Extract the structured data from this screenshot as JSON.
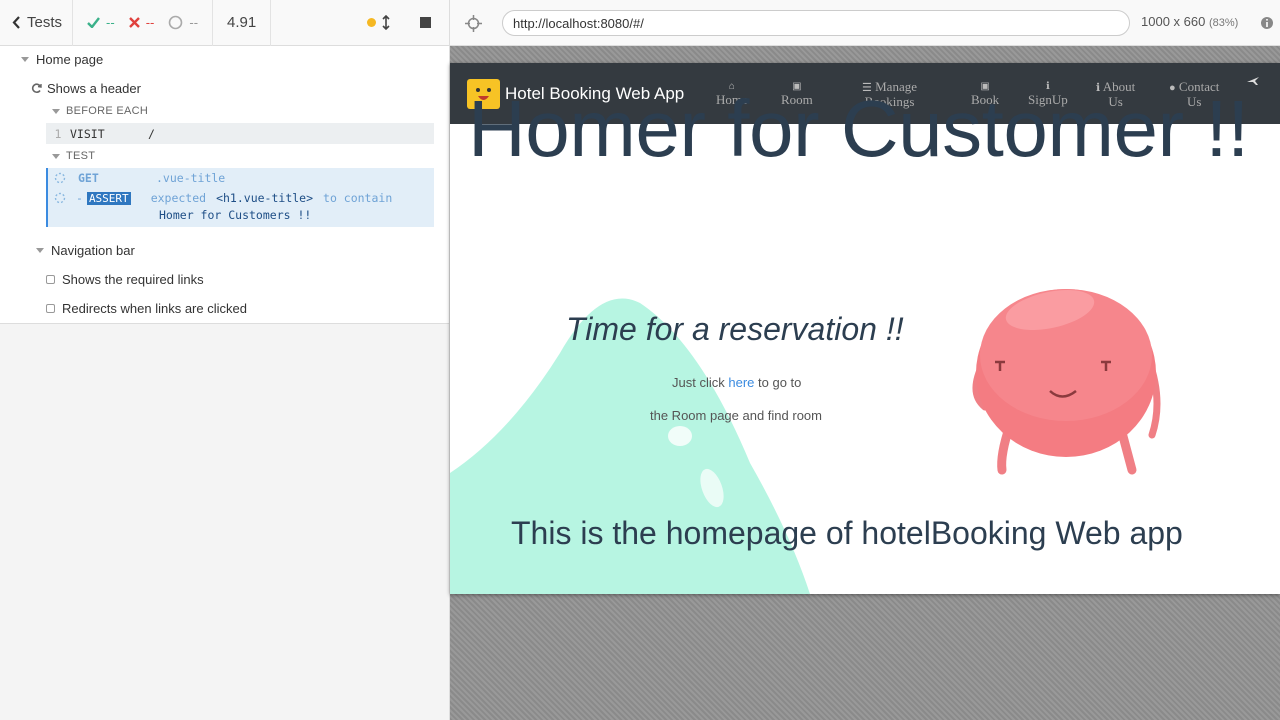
{
  "reporter": {
    "back_label": "Tests",
    "passed": "--",
    "failed": "--",
    "pending": "--",
    "duration": "4.91",
    "suite1": {
      "title": "Home page",
      "test1": {
        "title": "Shows a header",
        "hook_title": "BEFORE EACH",
        "hook_cmd": {
          "num": "1",
          "name": "VISIT",
          "msg": "/"
        },
        "test_title": "TEST",
        "get_cmd": {
          "name": "GET",
          "msg": ".vue-title"
        },
        "assert_cmd": {
          "name": "ASSERT",
          "msg_1": "expected",
          "msg_2": "<h1.vue-title>",
          "msg_3": "to contain",
          "msg_4": "Homer for Customers !!"
        }
      }
    },
    "suite2": {
      "title": "Navigation bar",
      "tests": [
        "Shows the required links",
        "Redirects when links are clicked"
      ]
    }
  },
  "aut": {
    "url": "http://localhost:8080/#/",
    "viewport": "1000 x 660",
    "scale": "(83%)",
    "app": {
      "brand": "Hotel Booking Web App",
      "nav": [
        {
          "icon": "home-icon",
          "line1": "Home",
          "line2": ""
        },
        {
          "icon": "room-icon",
          "line1": "Room",
          "line2": ""
        },
        {
          "icon": "list-icon",
          "line1": "Manage",
          "line2": "Bookings"
        },
        {
          "icon": "book-icon",
          "line1": "Book",
          "line2": ""
        },
        {
          "icon": "info-icon",
          "line1": "SignUp",
          "line2": ""
        },
        {
          "icon": "info-icon",
          "line1": "About",
          "line2": "Us"
        },
        {
          "icon": "chat-icon",
          "line1": "Contact",
          "line2": "Us"
        }
      ],
      "title": "Homer for Customer !!",
      "subtitle": "Time for a reservation !!",
      "line1_pre": "Just click",
      "line1_link": "here",
      "line1_post": "to go to",
      "line2": "the Room page and find room",
      "footer": "This is the homepage of hotelBooking Web app"
    }
  }
}
